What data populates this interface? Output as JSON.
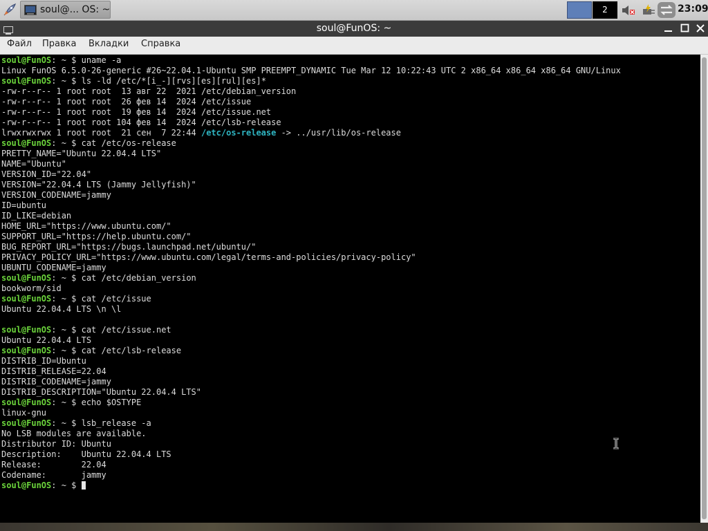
{
  "taskbar": {
    "task_label": "soul@...  OS: ~",
    "workspace_2": "2",
    "clock": "23:09"
  },
  "window": {
    "title": "soul@FunOS: ~",
    "menu": [
      "Файл",
      "Правка",
      "Вкладки",
      "Справка"
    ]
  },
  "prompt": {
    "user_host": "soul@FunOS",
    "suffix": ": ~ $ "
  },
  "terminal": {
    "lines": [
      {
        "kind": "prompt",
        "cmd": "uname -a"
      },
      {
        "kind": "out",
        "text": "Linux FunOS 6.5.0-26-generic #26~22.04.1-Ubuntu SMP PREEMPT_DYNAMIC Tue Mar 12 10:22:43 UTC 2 x86_64 x86_64 x86_64 GNU/Linux"
      },
      {
        "kind": "prompt",
        "cmd": "ls -ld /etc/*[i_-][rvs][es][rul][es]*"
      },
      {
        "kind": "out",
        "text": "-rw-r--r-- 1 root root  13 авг 22  2021 /etc/debian_version"
      },
      {
        "kind": "out",
        "text": "-rw-r--r-- 1 root root  26 фев 14  2024 /etc/issue"
      },
      {
        "kind": "out",
        "text": "-rw-r--r-- 1 root root  19 фев 14  2024 /etc/issue.net"
      },
      {
        "kind": "out",
        "text": "-rw-r--r-- 1 root root 104 фев 14  2024 /etc/lsb-release"
      },
      {
        "kind": "link",
        "pre": "lrwxrwxrwx 1 root root  21 сен  7 22:44 ",
        "link": "/etc/os-release",
        "post": " -> ../usr/lib/os-release"
      },
      {
        "kind": "prompt",
        "cmd": "cat /etc/os-release"
      },
      {
        "kind": "out",
        "text": "PRETTY_NAME=\"Ubuntu 22.04.4 LTS\""
      },
      {
        "kind": "out",
        "text": "NAME=\"Ubuntu\""
      },
      {
        "kind": "out",
        "text": "VERSION_ID=\"22.04\""
      },
      {
        "kind": "out",
        "text": "VERSION=\"22.04.4 LTS (Jammy Jellyfish)\""
      },
      {
        "kind": "out",
        "text": "VERSION_CODENAME=jammy"
      },
      {
        "kind": "out",
        "text": "ID=ubuntu"
      },
      {
        "kind": "out",
        "text": "ID_LIKE=debian"
      },
      {
        "kind": "out",
        "text": "HOME_URL=\"https://www.ubuntu.com/\""
      },
      {
        "kind": "out",
        "text": "SUPPORT_URL=\"https://help.ubuntu.com/\""
      },
      {
        "kind": "out",
        "text": "BUG_REPORT_URL=\"https://bugs.launchpad.net/ubuntu/\""
      },
      {
        "kind": "out",
        "text": "PRIVACY_POLICY_URL=\"https://www.ubuntu.com/legal/terms-and-policies/privacy-policy\""
      },
      {
        "kind": "out",
        "text": "UBUNTU_CODENAME=jammy"
      },
      {
        "kind": "prompt",
        "cmd": "cat /etc/debian_version"
      },
      {
        "kind": "out",
        "text": "bookworm/sid"
      },
      {
        "kind": "prompt",
        "cmd": "cat /etc/issue"
      },
      {
        "kind": "out",
        "text": "Ubuntu 22.04.4 LTS \\n \\l"
      },
      {
        "kind": "out",
        "text": ""
      },
      {
        "kind": "prompt",
        "cmd": "cat /etc/issue.net"
      },
      {
        "kind": "out",
        "text": "Ubuntu 22.04.4 LTS"
      },
      {
        "kind": "prompt",
        "cmd": "cat /etc/lsb-release"
      },
      {
        "kind": "out",
        "text": "DISTRIB_ID=Ubuntu"
      },
      {
        "kind": "out",
        "text": "DISTRIB_RELEASE=22.04"
      },
      {
        "kind": "out",
        "text": "DISTRIB_CODENAME=jammy"
      },
      {
        "kind": "out",
        "text": "DISTRIB_DESCRIPTION=\"Ubuntu 22.04.4 LTS\""
      },
      {
        "kind": "prompt",
        "cmd": "echo $OSTYPE"
      },
      {
        "kind": "out",
        "text": "linux-gnu"
      },
      {
        "kind": "prompt",
        "cmd": "lsb_release -a"
      },
      {
        "kind": "out",
        "text": "No LSB modules are available."
      },
      {
        "kind": "out",
        "text": "Distributor ID: Ubuntu"
      },
      {
        "kind": "out",
        "text": "Description:    Ubuntu 22.04.4 LTS"
      },
      {
        "kind": "out",
        "text": "Release:        22.04"
      },
      {
        "kind": "out",
        "text": "Codename:       jammy"
      },
      {
        "kind": "prompt",
        "cmd": "",
        "cursor": true
      }
    ]
  },
  "icons": {
    "launcher": "rocket-icon",
    "terminal": "terminal-icon",
    "volume": "volume-muted-icon",
    "power": "power-icon",
    "network": "network-icon",
    "ibeam": "text-cursor-icon"
  },
  "colors": {
    "prompt": "#6bd43b",
    "link": "#2fb6c3",
    "terminal_bg": "#000000",
    "titlebar": "#3b3b3b"
  }
}
